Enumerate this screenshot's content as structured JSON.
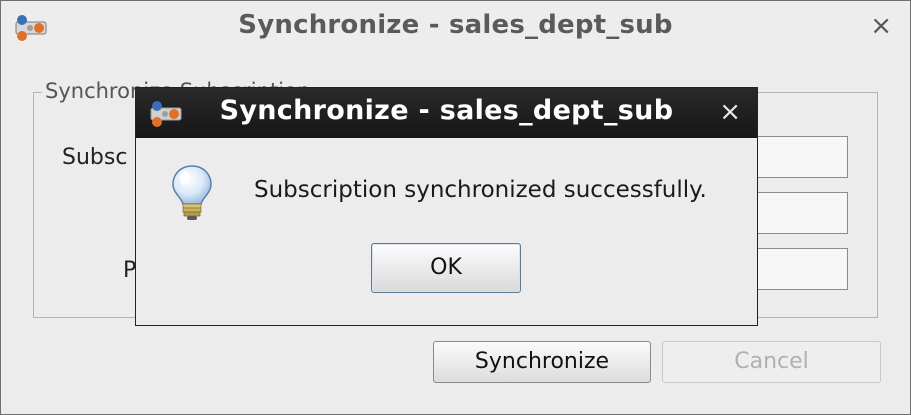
{
  "background_dialog": {
    "title": "Synchronize - sales_dept_sub",
    "close_glyph": "×",
    "group_label": "Synchronize Subscription",
    "label_1": "Subsc",
    "label_2": "P",
    "synchronize_label": "Synchronize",
    "cancel_label": "Cancel"
  },
  "message_dialog": {
    "title": "Synchronize - sales_dept_sub",
    "close_glyph": "×",
    "message": "Subscription synchronized successfully.",
    "ok_label": "OK",
    "icon": "lightbulb-icon"
  },
  "colors": {
    "active_titlebar": "#1e1e1e",
    "window_bg": "#ececec",
    "ok_focus_border": "#5e7a99"
  }
}
